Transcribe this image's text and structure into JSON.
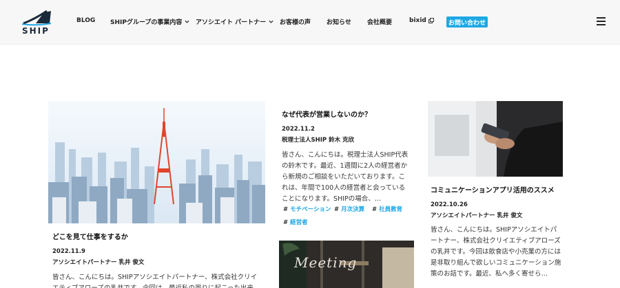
{
  "brand": {
    "logo_text": "SHIP"
  },
  "nav": {
    "blog": "BLOG",
    "ship_group": "SHIPグループの事業内容",
    "associate": "アソシエイト パートナー",
    "voices": "お客様の声",
    "news": "お知らせ",
    "company": "会社概要",
    "bixid": "bixid",
    "contact": "お問い合わせ"
  },
  "cards": {
    "c1": {
      "title": "どこを見て仕事をするか",
      "date": "2022.11.9",
      "author": "アソシエイトパートナー 乳井 俊文",
      "body": "皆さん、こんにちは。SHIPアソシエイトパートナー、株式会社クリイエティブアローズの乳井です。今回は、最近私の周りに起こった出来"
    },
    "c2": {
      "title": "なぜ代表が営業しないのか？",
      "date": "2022.11.2",
      "author": "税理士法人SHIP 鈴木 克欣",
      "body": "皆さん、こんにちは。税理士法人SHIP代表の鈴木です。最近、1週間に2人の経営者から新規のご相談をいただいております。これは、年間で100人の経営者と会っていることになります。SHIPの場合、…",
      "tags": [
        "モチベーション",
        "月次決算",
        "社員教育",
        "経営者"
      ]
    },
    "c3": {
      "title": "コミュニケーションアプリ活用のススメ",
      "date": "2022.10.26",
      "author": "アソシエイトパートナー 乳井 俊文",
      "body": "皆さん、こんにちは。SHIPアソシエイトパートナー、株式会社クリイエティブアローズの乳井です。今回は飲食店や小売業の方には是非取り組んで欲しいコミュニケーション施策のお話です。最近、私へ多く寄せら…"
    },
    "c4": {
      "image_text": "Meeting"
    }
  },
  "colors": {
    "accent": "#1ea7e4"
  }
}
